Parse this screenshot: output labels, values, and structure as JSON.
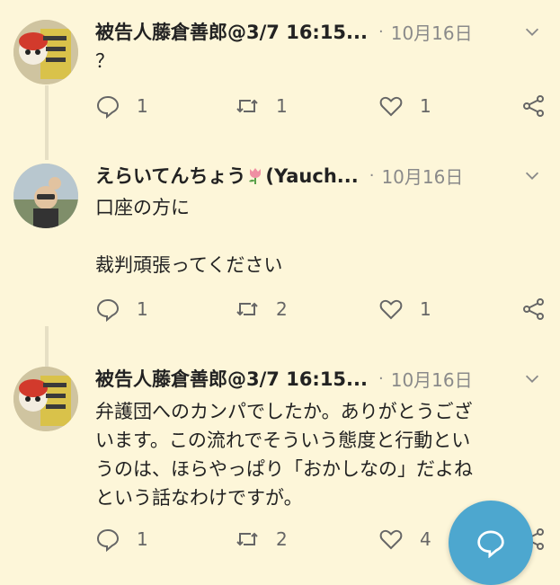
{
  "tweets": [
    {
      "author": "被告人藤倉善郎@3/7 16:15...",
      "separator": "·",
      "time": "10月16日",
      "text": "？",
      "replies": "1",
      "retweets": "1",
      "likes": "1"
    },
    {
      "author": "えらいてんちょう",
      "author_suffix": "(Yauch...",
      "separator": "·",
      "time": "10月16日",
      "text": "口座の方に\n\n裁判頑張ってください",
      "replies": "1",
      "retweets": "2",
      "likes": "1"
    },
    {
      "author": "被告人藤倉善郎@3/7 16:15...",
      "separator": "·",
      "time": "10月16日",
      "text": "弁護団へのカンパでしたか。ありがとうござ\nいます。この流れでそういう態度と行動とい\nうのは、ほらやっぱり「おかしなの」だよね\nという話なわけですが。",
      "replies": "1",
      "retweets": "2",
      "likes": "4"
    }
  ],
  "icons": {
    "reply": "reply-icon",
    "retweet": "retweet-icon",
    "like": "heart-icon",
    "share": "share-icon",
    "more": "chevron-down-icon",
    "compose": "compose-reply-icon",
    "name_emoji": "tulip-emoji"
  },
  "colors": {
    "background": "#fdf6d9",
    "fab": "#4da7cf",
    "muted": "#8a8a8a"
  }
}
